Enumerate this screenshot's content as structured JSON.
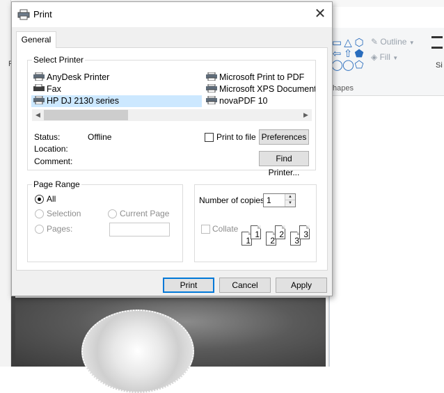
{
  "background": {
    "ribbon_outline_label": "Outline",
    "ribbon_fill_label": "Fill",
    "shapes_label": "hapes",
    "left_letter": "F",
    "right_label": "Si",
    "shape_glyphs": [
      "▭",
      "△",
      "⬡",
      "⇦",
      "⇧",
      "⬟",
      "◯",
      "◯",
      "⬠"
    ]
  },
  "dialog": {
    "title": "Print",
    "close_glyph": "✕",
    "tab_general": "General",
    "select_printer_legend": "Select Printer",
    "printers": [
      {
        "name": "AnyDesk Printer",
        "selected": false
      },
      {
        "name": "Fax",
        "selected": false
      },
      {
        "name": "HP DJ 2130 series",
        "selected": true
      },
      {
        "name": "Microsoft Print to PDF",
        "selected": false
      },
      {
        "name": "Microsoft XPS Document Writer",
        "selected": false
      },
      {
        "name": "novaPDF 10",
        "selected": false
      }
    ],
    "status_label": "Status:",
    "status_value": "Offline",
    "location_label": "Location:",
    "comment_label": "Comment:",
    "print_to_file_label": "Print to file",
    "preferences_button": "Preferences",
    "find_printer_button": "Find Printer...",
    "page_range_legend": "Page Range",
    "range_all": "All",
    "range_selection": "Selection",
    "range_current_page": "Current Page",
    "range_pages": "Pages:",
    "copies_label": "Number of copies:",
    "copies_value": "1",
    "collate_label": "Collate",
    "collate_numbers": [
      "1",
      "1",
      "2",
      "2",
      "3",
      "3"
    ],
    "print_button": "Print",
    "cancel_button": "Cancel",
    "apply_button": "Apply"
  },
  "colors": {
    "selection": "#cce8ff",
    "default_button_border": "#0078d7",
    "dialog_bg": "#f0f0f0"
  }
}
